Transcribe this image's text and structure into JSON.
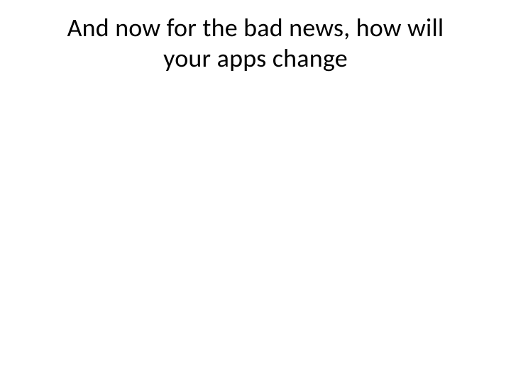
{
  "slide": {
    "title": "And now for the bad news, how will your apps change"
  }
}
